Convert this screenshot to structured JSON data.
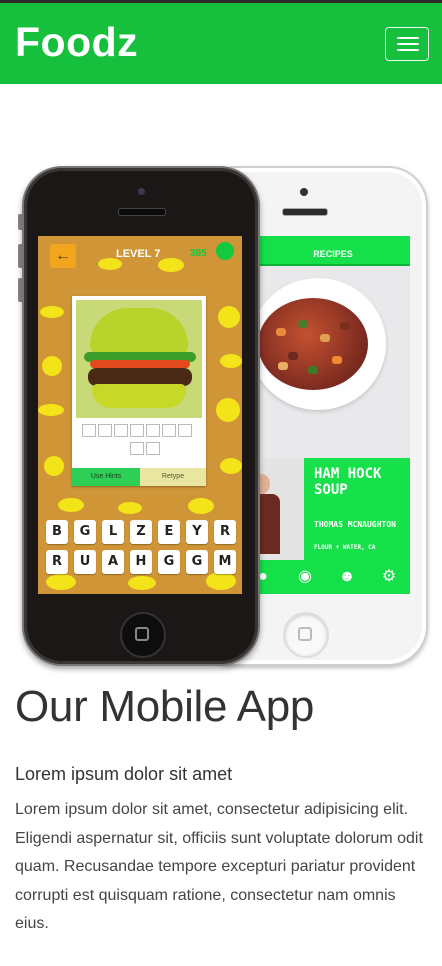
{
  "header": {
    "brand": "Foodz",
    "menu_icon": "hamburger-menu-icon"
  },
  "phone_left": {
    "level_label": "LEVEL 7",
    "coins": "385",
    "back_icon": "arrow-left-icon",
    "use_hints_label": "Use Hints",
    "retype_label": "Retype",
    "keyboard_rows": [
      [
        "B",
        "G",
        "L",
        "Z",
        "E",
        "Y",
        "R"
      ],
      [
        "R",
        "U",
        "A",
        "H",
        "G",
        "G",
        "M"
      ]
    ]
  },
  "phone_right": {
    "header_label": "RECIPES",
    "recipe_title": "HAM HOCK SOUP",
    "chef_name": "THOMAS MCNAUGHTON",
    "recipe_meta": "FLOUR + WATER, CA",
    "tab_icons": [
      "chef-hat-icon",
      "plate-cutlery-icon",
      "people-icon",
      "gear-icon"
    ]
  },
  "section": {
    "title": "Our Mobile App",
    "subtitle": "Lorem ipsum dolor sit amet",
    "body": "Lorem ipsum dolor sit amet, consectetur adipisicing elit. Eligendi aspernatur sit, officiis sunt voluptate dolorum odit quam. Recusandae tempore excepturi pariatur provident corrupti est quisquam ratione, consectetur nam omnis eius."
  },
  "colors": {
    "brand_green": "#16c03c",
    "app_green": "#15e04a",
    "game_orange": "#cf9536"
  }
}
